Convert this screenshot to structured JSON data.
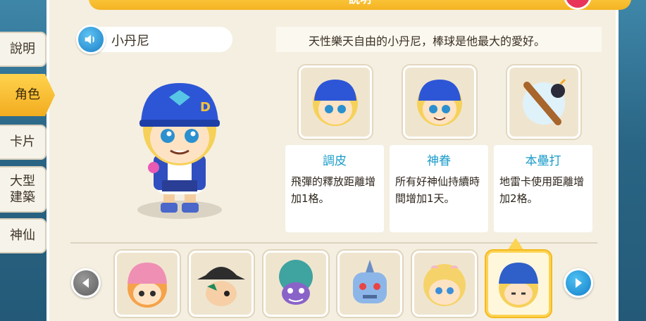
{
  "window": {
    "title": "說明"
  },
  "tabs": [
    {
      "label": "說明",
      "active": false
    },
    {
      "label": "角色",
      "active": true
    },
    {
      "label": "卡片",
      "active": false
    },
    {
      "label": "大型建築",
      "active": false
    },
    {
      "label": "神仙",
      "active": false
    }
  ],
  "character": {
    "name": "小丹尼",
    "description": "天性樂天自由的小丹尼，棒球是他最大的愛好。"
  },
  "skills": [
    {
      "title": "調皮",
      "desc": "飛彈的釋放距離增加1格。"
    },
    {
      "title": "神眷",
      "desc": "所有好神仙持續時間增加1天。"
    },
    {
      "title": "本壘打",
      "desc": "地雷卡使用距離增加2格。"
    }
  ],
  "carousel": {
    "characters": [
      {
        "icon": "pink-hat-girl-icon",
        "color": "#f08fb4"
      },
      {
        "icon": "cowboy-hat-boy-icon",
        "color": "#2d2d2d"
      },
      {
        "icon": "octopus-villain-icon",
        "color": "#3fa3a0"
      },
      {
        "icon": "robot-icon",
        "color": "#8db6e8"
      },
      {
        "icon": "blonde-girl-icon",
        "color": "#f6d36a"
      },
      {
        "icon": "danny-boy-icon",
        "color": "#2f5fc8",
        "selected": true
      }
    ]
  },
  "colors": {
    "accent": "#f4b322",
    "skill_title": "#1a9bc9",
    "close": "#e8345a"
  }
}
